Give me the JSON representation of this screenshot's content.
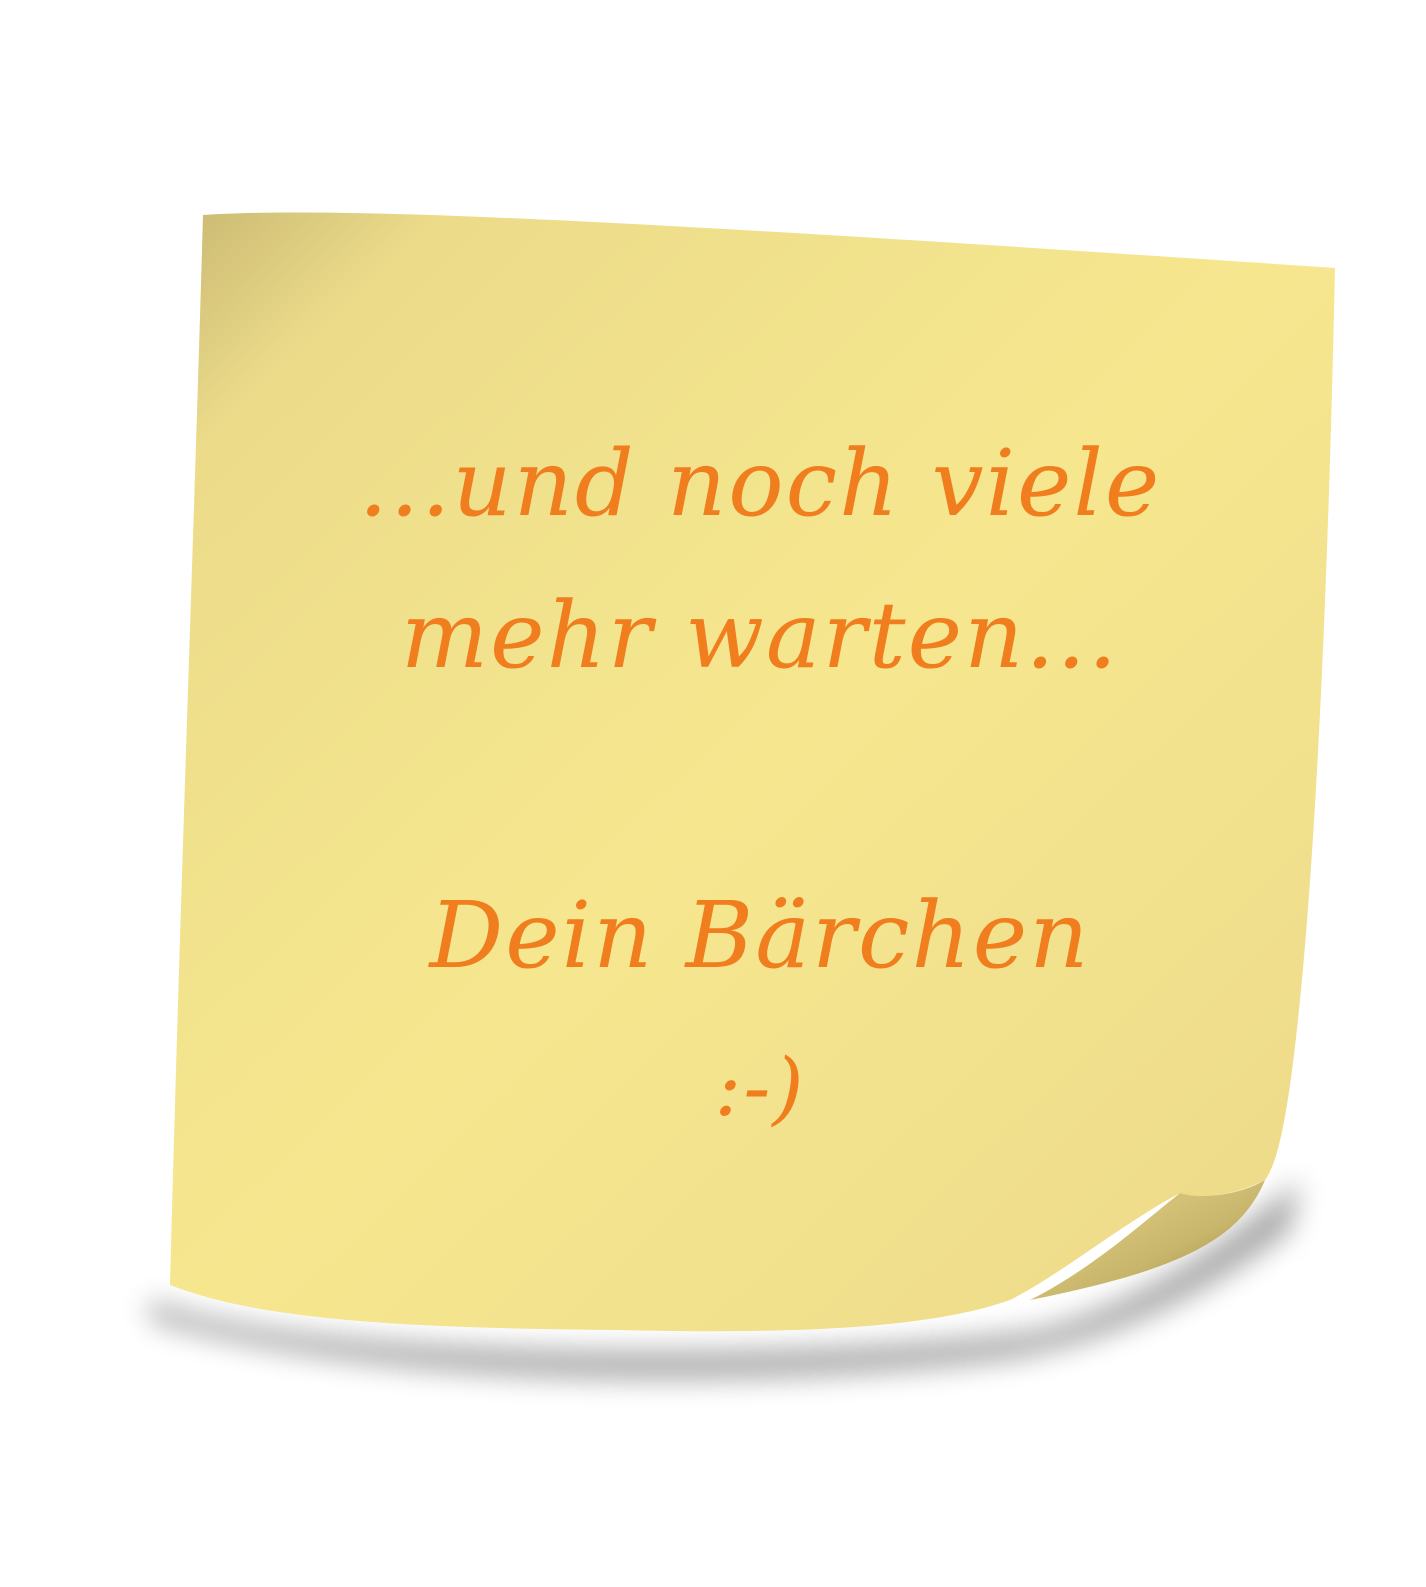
{
  "note": {
    "line1": "...und noch viele",
    "line2": "mehr warten...",
    "signature": "Dein Bärchen",
    "smiley": ":-)"
  },
  "colors": {
    "paper": "#f3e38e",
    "paper_light": "#f8e98f",
    "paper_shade": "#cdbd72",
    "ink": "#f07d1e",
    "background": "#ffffff"
  }
}
